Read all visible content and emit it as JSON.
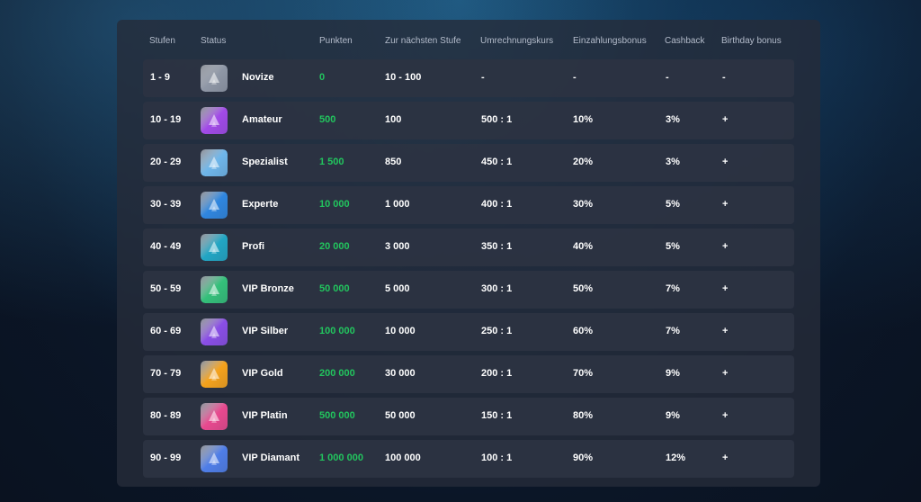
{
  "header": {
    "stufen": "Stufen",
    "status": "Status",
    "punkten": "Punkten",
    "next": "Zur nächsten Stufe",
    "rate": "Umrechnungskurs",
    "deposit": "Einzahlungsbonus",
    "cashback": "Cashback",
    "birthday": "Birthday bonus"
  },
  "rows": [
    {
      "stufen": "1 - 9",
      "name": "Novize",
      "points": "0",
      "next": "10 - 100",
      "rate": "-",
      "deposit": "-",
      "cashback": "-",
      "birthday": "-",
      "icon": "novice-badge-icon",
      "color": "#8f97a6"
    },
    {
      "stufen": "10 - 19",
      "name": "Amateur",
      "points": "500",
      "next": "100",
      "rate": "500 : 1",
      "deposit": "10%",
      "cashback": "3%",
      "birthday": "+",
      "icon": "amateur-badge-icon",
      "color": "#a24ae8"
    },
    {
      "stufen": "20 - 29",
      "name": "Spezialist",
      "points": "1 500",
      "next": "850",
      "rate": "450 : 1",
      "deposit": "20%",
      "cashback": "3%",
      "birthday": "+",
      "icon": "specialist-badge-icon",
      "color": "#6fb6ea"
    },
    {
      "stufen": "30 - 39",
      "name": "Experte",
      "points": "10 000",
      "next": "1 000",
      "rate": "400 : 1",
      "deposit": "30%",
      "cashback": "5%",
      "birthday": "+",
      "icon": "expert-badge-icon",
      "color": "#2f86df"
    },
    {
      "stufen": "40 - 49",
      "name": "Profi",
      "points": "20 000",
      "next": "3 000",
      "rate": "350 : 1",
      "deposit": "40%",
      "cashback": "5%",
      "birthday": "+",
      "icon": "profi-badge-icon",
      "color": "#22a6c4"
    },
    {
      "stufen": "50 - 59",
      "name": "VIP Bronze",
      "points": "50 000",
      "next": "5 000",
      "rate": "300 : 1",
      "deposit": "50%",
      "cashback": "7%",
      "birthday": "+",
      "icon": "vip-bronze-badge-icon",
      "color": "#34c07a"
    },
    {
      "stufen": "60 - 69",
      "name": "VIP Silber",
      "points": "100 000",
      "next": "10 000",
      "rate": "250 : 1",
      "deposit": "60%",
      "cashback": "7%",
      "birthday": "+",
      "icon": "vip-silber-badge-icon",
      "color": "#8a4ee6"
    },
    {
      "stufen": "70 - 79",
      "name": "VIP Gold",
      "points": "200 000",
      "next": "30 000",
      "rate": "200 : 1",
      "deposit": "70%",
      "cashback": "9%",
      "birthday": "+",
      "icon": "vip-gold-badge-icon",
      "color": "#f5a21c"
    },
    {
      "stufen": "80 - 89",
      "name": "VIP Platin",
      "points": "500 000",
      "next": "50 000",
      "rate": "150 : 1",
      "deposit": "80%",
      "cashback": "9%",
      "birthday": "+",
      "icon": "vip-platin-badge-icon",
      "color": "#e8498f"
    },
    {
      "stufen": "90 - 99",
      "name": "VIP Diamant",
      "points": "1 000 000",
      "next": "100 000",
      "rate": "100 : 1",
      "deposit": "90%",
      "cashback": "12%",
      "birthday": "+",
      "icon": "vip-diamant-badge-icon",
      "color": "#4f7ee8"
    }
  ]
}
